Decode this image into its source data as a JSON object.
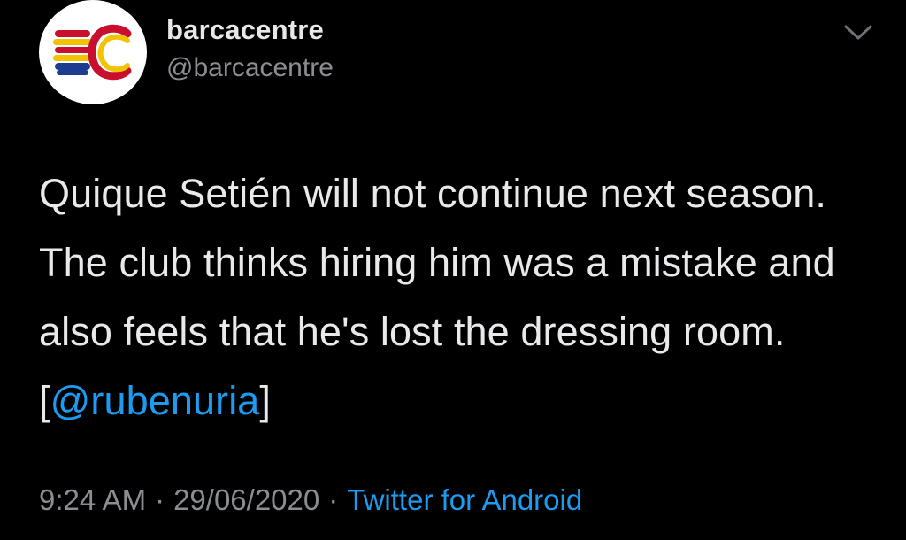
{
  "profile": {
    "display_name": "barcacentre",
    "handle": "@barcacentre",
    "avatar_icon": "barcacentre-logo-icon"
  },
  "menu": {
    "icon": "chevron-down-icon"
  },
  "tweet": {
    "text_before": "Quique Setién will not continue next season. The club thinks hiring him was a mistake and also feels that he's lost the dressing room. [",
    "mention": "@rubenuria",
    "text_after": "]"
  },
  "meta": {
    "time": "9:24 AM",
    "separator": "·",
    "date": "29/06/2020",
    "source": "Twitter for Android"
  },
  "colors": {
    "background": "#000000",
    "link": "#1d9bf0",
    "secondary_text": "#8a8d91"
  }
}
